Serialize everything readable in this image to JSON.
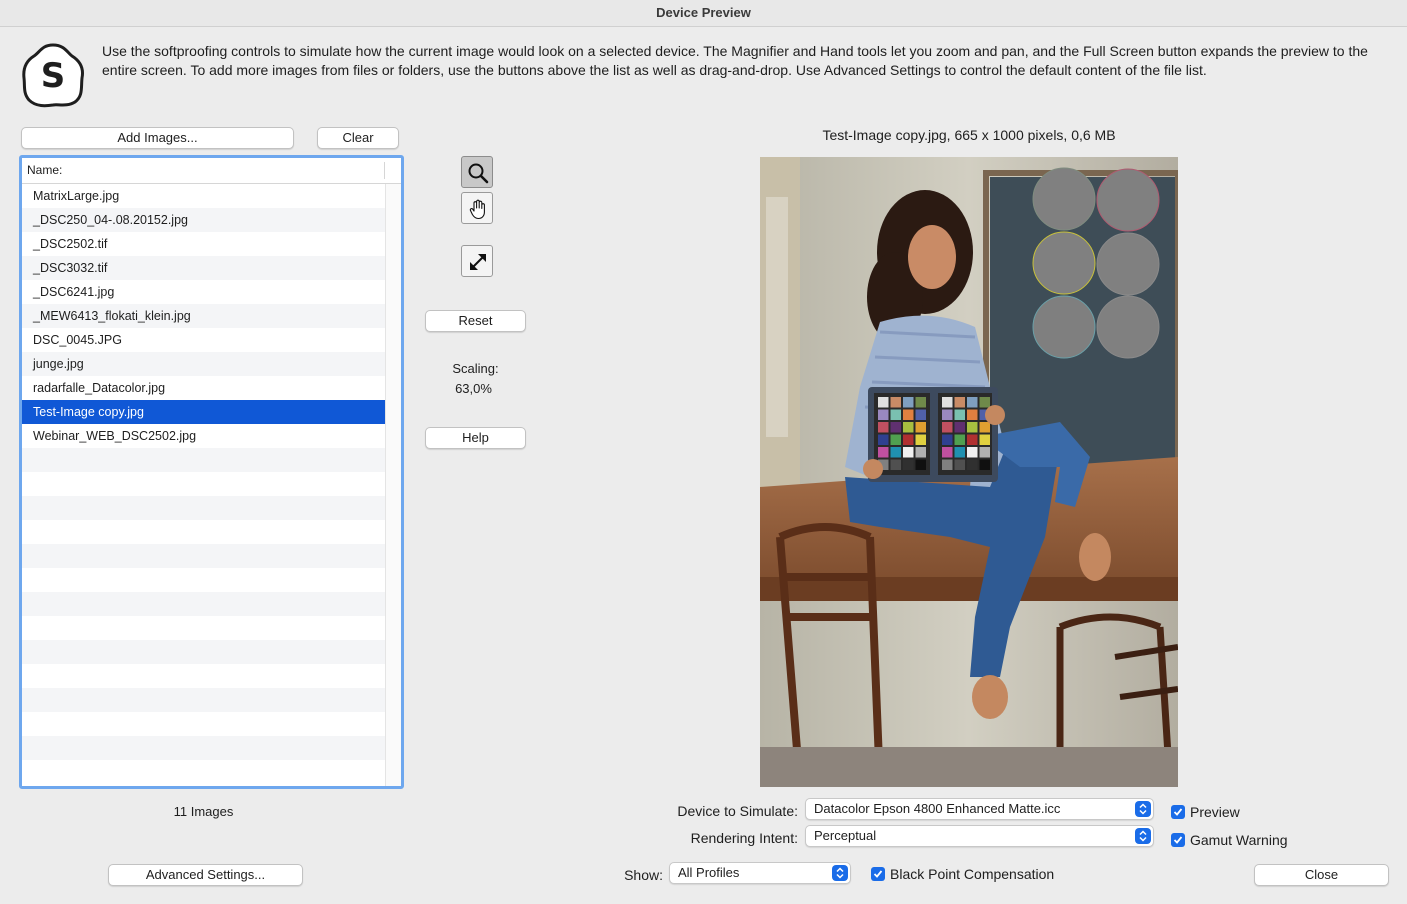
{
  "window": {
    "title": "Device Preview"
  },
  "header": {
    "logo_letter": "S",
    "description": "Use the softproofing controls to simulate how the current image would look on a selected device. The Magnifier and Hand tools let you zoom and pan, and the Full Screen button expands the preview to the entire screen. To add more images from files or folders, use the buttons above the list as well as drag-and-drop. Use Advanced Settings to control the default content of the file list."
  },
  "list_controls": {
    "add_label": "Add Images...",
    "clear_label": "Clear"
  },
  "file_list": {
    "column_header": "Name:",
    "items": [
      "MatrixLarge.jpg",
      "_DSC250_04-.08.20152.jpg",
      "_DSC2502.tif",
      "_DSC3032.tif",
      "_DSC6241.jpg",
      "_MEW6413_flokati_klein.jpg",
      "DSC_0045.JPG",
      "junge.jpg",
      "radarfalle_Datacolor.jpg",
      "Test-Image copy.jpg",
      "Webinar_WEB_DSC2502.jpg"
    ],
    "selected_index": 9,
    "count_label": "11 Images"
  },
  "tools": {
    "magnifier_icon": "magnifier-icon",
    "hand_icon": "hand-icon",
    "fullscreen_icon": "fullscreen-icon",
    "reset_label": "Reset",
    "scaling_label": "Scaling:",
    "scaling_value": "63,0%",
    "help_label": "Help"
  },
  "preview": {
    "image_info": "Test-Image copy.jpg, 665 x 1000 pixels, 0,6 MB"
  },
  "settings": {
    "device_label": "Device to Simulate:",
    "device_value": "Datacolor Epson 4800 Enhanced Matte.icc",
    "intent_label": "Rendering Intent:",
    "intent_value": "Perceptual",
    "show_label": "Show:",
    "show_value": "All Profiles",
    "preview_label": "Preview",
    "preview_checked": true,
    "gamut_label": "Gamut Warning",
    "gamut_checked": true,
    "bpc_label": "Black Point Compensation",
    "bpc_checked": true
  },
  "footer": {
    "advanced_label": "Advanced Settings...",
    "close_label": "Close"
  },
  "colors": {
    "accent": "#1a6ce8",
    "selection": "#1058d6",
    "list_focus": "#6ea7ee"
  }
}
